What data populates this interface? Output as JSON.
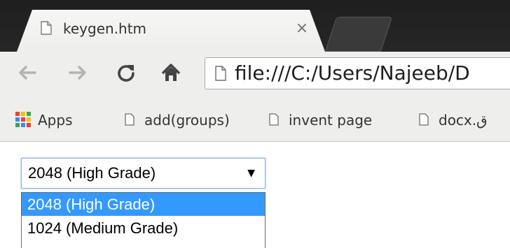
{
  "browser": {
    "tab": {
      "title": "keygen.htm",
      "close_glyph": "×"
    },
    "toolbar": {
      "back_icon": "back-arrow-icon",
      "forward_icon": "forward-arrow-icon",
      "reload_icon": "reload-icon",
      "home_icon": "home-icon",
      "url": "file:///C:/Users/Najeeb/D"
    },
    "bookmarks": [
      {
        "label": "Apps",
        "icon": "apps-grid-icon"
      },
      {
        "label": "add(groups)",
        "icon": "page-icon"
      },
      {
        "label": "invent page",
        "icon": "page-icon"
      },
      {
        "label": "docx.ق",
        "icon": "page-icon"
      }
    ]
  },
  "page": {
    "keysize_select": {
      "value": "2048 (High Grade)",
      "arrow_glyph": "▼",
      "options": [
        {
          "label": "2048 (High Grade)",
          "selected": true
        },
        {
          "label": "1024 (Medium Grade)",
          "selected": false
        }
      ]
    }
  },
  "colors": {
    "selection_highlight": "#3399ff",
    "chrome_dark": "#262626",
    "toolbar_bg": "#eeeeec",
    "focus_ring": "#8ab0e0"
  }
}
